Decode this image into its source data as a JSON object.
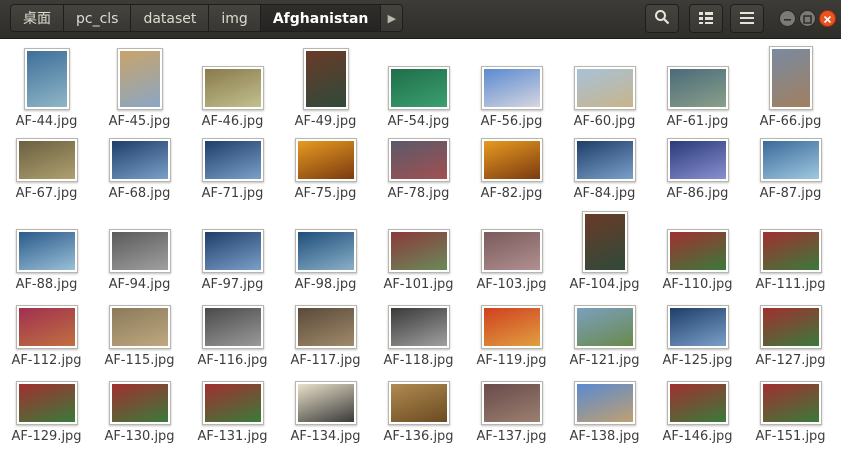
{
  "breadcrumb": [
    "桌面",
    "pc_cls",
    "dataset",
    "img",
    "Afghanistan"
  ],
  "toolbar": {
    "search_icon": "search-icon",
    "view_icon": "list-view-icon",
    "menu_icon": "hamburger-menu-icon"
  },
  "colors": {
    "header_bg": "#2e2d2a",
    "close_button": "#e95420",
    "window_button": "#7b7a76",
    "label_text": "#3c3c3c"
  },
  "files": [
    {
      "name": "AF-44.jpg",
      "c1": "#3e6f9a",
      "c2": "#8fb6c7"
    },
    {
      "name": "AF-45.jpg",
      "c1": "#c9a36a",
      "c2": "#8aa7c4"
    },
    {
      "name": "AF-46.jpg",
      "c1": "#8a7a4a",
      "c2": "#c2c090"
    },
    {
      "name": "AF-49.jpg",
      "c1": "#6a3a28",
      "c2": "#2f4a3a"
    },
    {
      "name": "AF-54.jpg",
      "c1": "#1f6e4a",
      "c2": "#3aa070"
    },
    {
      "name": "AF-56.jpg",
      "c1": "#5a8ad0",
      "c2": "#d6d6e0"
    },
    {
      "name": "AF-60.jpg",
      "c1": "#a7c2d8",
      "c2": "#c8b48a"
    },
    {
      "name": "AF-61.jpg",
      "c1": "#4a6a7a",
      "c2": "#8aa08a"
    },
    {
      "name": "AF-66.jpg",
      "c1": "#7a8aa0",
      "c2": "#a08060"
    },
    {
      "name": "AF-67.jpg",
      "c1": "#6a6040",
      "c2": "#b0a070"
    },
    {
      "name": "AF-68.jpg",
      "c1": "#1f3e6a",
      "c2": "#7aa0c8"
    },
    {
      "name": "AF-71.jpg",
      "c1": "#1f3e6a",
      "c2": "#7aa0c8"
    },
    {
      "name": "AF-75.jpg",
      "c1": "#e89a20",
      "c2": "#7a3a10"
    },
    {
      "name": "AF-78.jpg",
      "c1": "#5a5a6a",
      "c2": "#a05050"
    },
    {
      "name": "AF-82.jpg",
      "c1": "#e89a20",
      "c2": "#7a3a10"
    },
    {
      "name": "AF-84.jpg",
      "c1": "#1f3e6a",
      "c2": "#7aa0c8"
    },
    {
      "name": "AF-86.jpg",
      "c1": "#2a3a7a",
      "c2": "#8a90d0"
    },
    {
      "name": "AF-87.jpg",
      "c1": "#3a6a9a",
      "c2": "#a0c8e0"
    },
    {
      "name": "AF-88.jpg",
      "c1": "#2a5a8a",
      "c2": "#9ac0d8"
    },
    {
      "name": "AF-94.jpg",
      "c1": "#5a5a5a",
      "c2": "#a0a0a0"
    },
    {
      "name": "AF-97.jpg",
      "c1": "#1f3e6a",
      "c2": "#7aa0c8"
    },
    {
      "name": "AF-98.jpg",
      "c1": "#1f4e7a",
      "c2": "#8ab0c8"
    },
    {
      "name": "AF-101.jpg",
      "c1": "#8a3a3a",
      "c2": "#6a8a5a"
    },
    {
      "name": "AF-103.jpg",
      "c1": "#7a5a5a",
      "c2": "#b09090"
    },
    {
      "name": "AF-104.jpg",
      "c1": "#6a3a28",
      "c2": "#2f4a3a"
    },
    {
      "name": "AF-110.jpg",
      "c1": "#a03030",
      "c2": "#3a7a3a"
    },
    {
      "name": "AF-111.jpg",
      "c1": "#a03030",
      "c2": "#3a7a3a"
    },
    {
      "name": "AF-112.jpg",
      "c1": "#a03050",
      "c2": "#c07040"
    },
    {
      "name": "AF-115.jpg",
      "c1": "#8a7a5a",
      "c2": "#c0a880"
    },
    {
      "name": "AF-116.jpg",
      "c1": "#4a4a4a",
      "c2": "#9a9a9a"
    },
    {
      "name": "AF-117.jpg",
      "c1": "#5a4a3a",
      "c2": "#a08a6a"
    },
    {
      "name": "AF-118.jpg",
      "c1": "#3a3a3a",
      "c2": "#a0a0a0"
    },
    {
      "name": "AF-119.jpg",
      "c1": "#d04020",
      "c2": "#e0a040"
    },
    {
      "name": "AF-121.jpg",
      "c1": "#7aa0c0",
      "c2": "#6a8a4a"
    },
    {
      "name": "AF-125.jpg",
      "c1": "#1f3e6a",
      "c2": "#7aa0c8"
    },
    {
      "name": "AF-127.jpg",
      "c1": "#a03030",
      "c2": "#3a7a3a"
    },
    {
      "name": "AF-129.jpg",
      "c1": "#a03030",
      "c2": "#3a7a3a"
    },
    {
      "name": "AF-130.jpg",
      "c1": "#a03030",
      "c2": "#3a7a3a"
    },
    {
      "name": "AF-131.jpg",
      "c1": "#a03030",
      "c2": "#3a7a3a"
    },
    {
      "name": "AF-134.jpg",
      "c1": "#e8e0c8",
      "c2": "#3a3a3a"
    },
    {
      "name": "AF-136.jpg",
      "c1": "#b08a50",
      "c2": "#6a4a20"
    },
    {
      "name": "AF-137.jpg",
      "c1": "#6a4a4a",
      "c2": "#9a8070"
    },
    {
      "name": "AF-138.jpg",
      "c1": "#5a8ad0",
      "c2": "#c0a070"
    },
    {
      "name": "AF-146.jpg",
      "c1": "#a03030",
      "c2": "#3a7a3a"
    },
    {
      "name": "AF-151.jpg",
      "c1": "#a03030",
      "c2": "#3a7a3a"
    }
  ]
}
